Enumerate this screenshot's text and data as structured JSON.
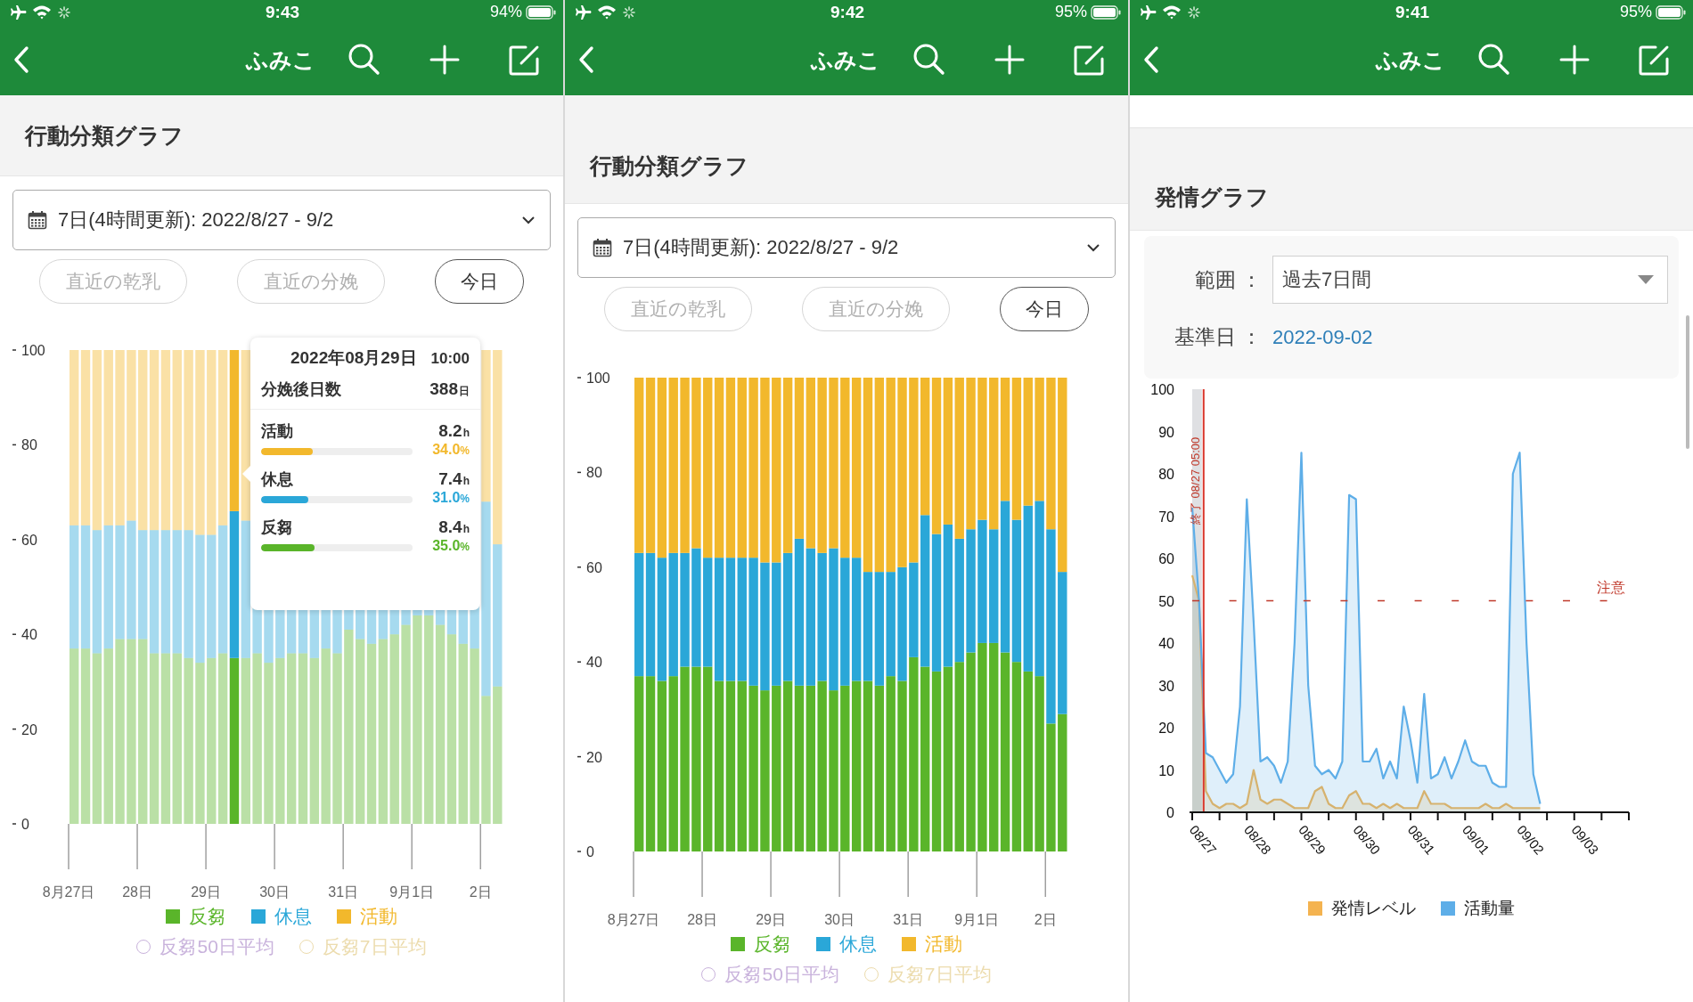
{
  "screens": [
    {
      "kind": "behavior",
      "status_bar": {
        "time": "9:43",
        "battery": "94%"
      },
      "nav": {
        "title": "ふみこ"
      },
      "section_title": "行動分類グラフ",
      "period": "7日(4時間更新): 2022/8/27 - 9/2",
      "buttons": [
        {
          "label": "直近の乾乳",
          "disabled": true
        },
        {
          "label": "直近の分娩",
          "disabled": true
        },
        {
          "label": "今日",
          "disabled": false
        }
      ],
      "chart_data": {
        "type": "bar",
        "stacked": true,
        "categories": [
          "8月27日",
          null,
          null,
          null,
          null,
          null,
          "28日",
          null,
          null,
          null,
          null,
          null,
          "29日",
          null,
          null,
          null,
          null,
          null,
          "30日",
          null,
          null,
          null,
          null,
          null,
          "31日",
          null,
          null,
          null,
          null,
          null,
          "9月1日",
          null,
          null,
          null,
          null,
          null,
          "2日",
          null
        ],
        "ylim": [
          0,
          100
        ],
        "yticks": [
          0,
          20,
          40,
          60,
          80,
          100
        ],
        "series": [
          {
            "name": "反芻",
            "color": "#5ab52a",
            "values": [
              37,
              37,
              36,
              37,
              39,
              39,
              39,
              36,
              36,
              36,
              35,
              34,
              35,
              36,
              35,
              35,
              36,
              34,
              35,
              36,
              36,
              35,
              37,
              36,
              41,
              39,
              38,
              39,
              40,
              42,
              44,
              44,
              42,
              40,
              38,
              37,
              27,
              29
            ]
          },
          {
            "name": "休息",
            "color": "#2aa7d8",
            "values": [
              26,
              26,
              26,
              26,
              24,
              25,
              23,
              26,
              26,
              26,
              27,
              27,
              26,
              27,
              31,
              29,
              null,
              null,
              null,
              null,
              null,
              null,
              null,
              null,
              null,
              null,
              null,
              null,
              null,
              null,
              null,
              null,
              null,
              null,
              null,
              null,
              41,
              30
            ]
          },
          {
            "name": "活動",
            "color": "#f2b82c",
            "values": [
              37,
              37,
              38,
              37,
              37,
              36,
              38,
              38,
              38,
              38,
              38,
              39,
              39,
              37,
              34,
              36,
              null,
              null,
              null,
              null,
              null,
              null,
              null,
              null,
              null,
              null,
              null,
              null,
              null,
              null,
              null,
              null,
              null,
              null,
              null,
              null,
              32,
              41
            ]
          }
        ]
      },
      "tooltip": {
        "date": "2022年08月29日",
        "time": "10:00",
        "days_label": "分娩後日数",
        "days_value": "388",
        "days_unit": "日",
        "rows": [
          {
            "label": "活動",
            "hours": "8.2",
            "hours_unit": "h",
            "level": 0.34,
            "percent": "34.0",
            "percent_unit": "%",
            "color": "#f2b82c"
          },
          {
            "label": "休息",
            "hours": "7.4",
            "hours_unit": "h",
            "level": 0.31,
            "percent": "31.0",
            "percent_unit": "%",
            "color": "#2aa7d8"
          },
          {
            "label": "反芻",
            "hours": "8.4",
            "hours_unit": "h",
            "level": 0.35,
            "percent": "35.0",
            "percent_unit": "%",
            "color": "#5ab52a"
          }
        ]
      },
      "averages": [
        {
          "label": "反芻50日平均",
          "on": false,
          "color": "#c9b3dc"
        },
        {
          "label": "反芻7日平均",
          "on": false,
          "color": "#ecdcae"
        }
      ]
    },
    {
      "kind": "behavior",
      "status_bar": {
        "time": "9:42",
        "battery": "95%"
      },
      "nav": {
        "title": "ふみこ"
      },
      "section_title": "行動分類グラフ",
      "period": "7日(4時間更新): 2022/8/27 - 9/2",
      "buttons": [
        {
          "label": "直近の乾乳",
          "disabled": true
        },
        {
          "label": "直近の分娩",
          "disabled": true
        },
        {
          "label": "今日",
          "disabled": false
        }
      ],
      "chart_data": {
        "type": "bar",
        "stacked": true,
        "categories": [
          "8月27日",
          null,
          null,
          null,
          null,
          null,
          "28日",
          null,
          null,
          null,
          null,
          null,
          "29日",
          null,
          null,
          null,
          null,
          null,
          "30日",
          null,
          null,
          null,
          null,
          null,
          "31日",
          null,
          null,
          null,
          null,
          null,
          "9月1日",
          null,
          null,
          null,
          null,
          null,
          "2日",
          null
        ],
        "ylim": [
          0,
          100
        ],
        "yticks": [
          0,
          20,
          40,
          60,
          80,
          100
        ],
        "series": [
          {
            "name": "反芻",
            "color": "#5ab52a",
            "values": [
              37,
              37,
              36,
              37,
              39,
              39,
              39,
              36,
              36,
              36,
              35,
              34,
              35,
              36,
              35,
              35,
              36,
              34,
              35,
              36,
              36,
              35,
              37,
              36,
              41,
              39,
              38,
              39,
              40,
              42,
              44,
              44,
              42,
              40,
              38,
              37,
              27,
              29
            ]
          },
          {
            "name": "休息",
            "color": "#2aa7d8",
            "values": [
              26,
              26,
              26,
              26,
              24,
              25,
              23,
              26,
              26,
              26,
              27,
              27,
              26,
              27,
              31,
              29,
              27,
              30,
              27,
              26,
              23,
              24,
              22,
              24,
              20,
              32,
              29,
              30,
              26,
              26,
              26,
              24,
              32,
              30,
              35,
              37,
              41,
              30
            ]
          },
          {
            "name": "活動",
            "color": "#f2b82c",
            "values": [
              37,
              37,
              38,
              37,
              37,
              36,
              38,
              38,
              38,
              38,
              38,
              39,
              39,
              37,
              34,
              36,
              37,
              36,
              38,
              38,
              41,
              41,
              41,
              40,
              39,
              29,
              33,
              31,
              34,
              32,
              30,
              32,
              26,
              30,
              27,
              26,
              32,
              41
            ]
          }
        ]
      },
      "averages": [
        {
          "label": "反芻50日平均",
          "on": false,
          "color": "#c9b3dc"
        },
        {
          "label": "反芻7日平均",
          "on": false,
          "color": "#ecdcae"
        }
      ]
    },
    {
      "kind": "estrus",
      "status_bar": {
        "time": "9:41",
        "battery": "95%"
      },
      "nav": {
        "title": "ふみこ"
      },
      "section_title": "発情グラフ",
      "range": {
        "label": "範囲 ：",
        "value": "過去7日間"
      },
      "base_date": {
        "label": "基準日 ：",
        "value": "2022-09-02"
      },
      "chart_data": {
        "type": "area",
        "categories": [
          "08/27",
          null,
          null,
          null,
          null,
          null,
          null,
          null,
          "08/28",
          null,
          null,
          null,
          null,
          null,
          null,
          null,
          "08/29",
          null,
          null,
          null,
          null,
          null,
          null,
          null,
          "08/30",
          null,
          null,
          null,
          null,
          null,
          null,
          null,
          "08/31",
          null,
          null,
          null,
          null,
          null,
          null,
          null,
          "09/01",
          null,
          null,
          null,
          null,
          null,
          null,
          null,
          "09/02",
          null,
          null,
          null,
          null,
          null,
          null,
          null,
          "09/03",
          null,
          null,
          null,
          null,
          null,
          null,
          null,
          null
        ],
        "ylim": [
          0,
          100
        ],
        "yticks": [
          0,
          10,
          20,
          30,
          40,
          50,
          60,
          70,
          80,
          90,
          100
        ],
        "series": [
          {
            "name": "発情レベル",
            "color": "#f4b350",
            "values": [
              56,
              50,
              5,
              2,
              1,
              2,
              2,
              1,
              2,
              10,
              3,
              2,
              3,
              3,
              2,
              1,
              1,
              1,
              5,
              6,
              2,
              1,
              1,
              4,
              5,
              2,
              2,
              1,
              2,
              1,
              2,
              1,
              1,
              1,
              5,
              2,
              2,
              2,
              1,
              1,
              1,
              1,
              1,
              2,
              1,
              1,
              2,
              1,
              1,
              1,
              1,
              1,
              null,
              null,
              null,
              null,
              null,
              null,
              null,
              null,
              null,
              null,
              null,
              null,
              null
            ]
          },
          {
            "name": "活動量",
            "color": "#5eaee8",
            "values": [
              72,
              50,
              14,
              13,
              10,
              7,
              9,
              25,
              74,
              45,
              12,
              13,
              11,
              7,
              12,
              40,
              85,
              30,
              11,
              9,
              10,
              8,
              12,
              75,
              74,
              12,
              12,
              15,
              8,
              12,
              8,
              25,
              17,
              7,
              28,
              8,
              9,
              13,
              8,
              12,
              17,
              12,
              11,
              11,
              7,
              6,
              6,
              80,
              85,
              40,
              9,
              2,
              null,
              null,
              null,
              null,
              null,
              null,
              null,
              null,
              null,
              null,
              null,
              null,
              null
            ]
          }
        ],
        "ref_lines": [
          {
            "axis": "y",
            "value": 50,
            "label": "注意"
          }
        ],
        "annotations": [
          "終了 08/27 05:00"
        ]
      }
    }
  ]
}
